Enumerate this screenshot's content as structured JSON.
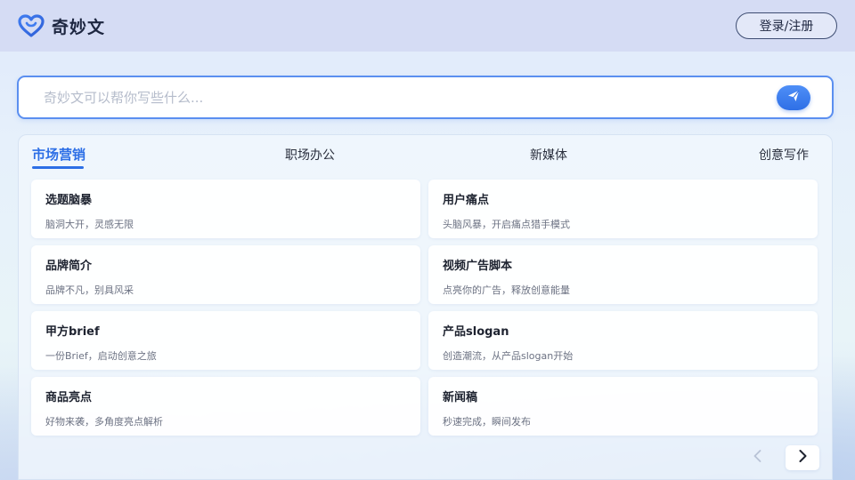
{
  "header": {
    "brand_name": "奇妙文",
    "login_label": "登录/注册"
  },
  "search": {
    "placeholder": "奇妙文可以帮你写些什么..."
  },
  "tabs": [
    {
      "label": "市场营销",
      "active": true
    },
    {
      "label": "职场办公",
      "active": false
    },
    {
      "label": "新媒体",
      "active": false
    },
    {
      "label": "创意写作",
      "active": false
    }
  ],
  "cards": [
    {
      "title": "选题脑暴",
      "desc": "脑洞大开，灵感无限"
    },
    {
      "title": "用户痛点",
      "desc": "头脑风暴，开启痛点猎手模式"
    },
    {
      "title": "品牌简介",
      "desc": "品牌不凡，别具风采"
    },
    {
      "title": "视频广告脚本",
      "desc": "点亮你的广告，释放创意能量"
    },
    {
      "title": "甲方brief",
      "desc": "一份Brief，启动创意之旅"
    },
    {
      "title": "产品slogan",
      "desc": "创造潮流，从产品slogan开始"
    },
    {
      "title": "商品亮点",
      "desc": "好物来袭，多角度亮点解析"
    },
    {
      "title": "新闻稿",
      "desc": "秒速完成，瞬间发布"
    }
  ],
  "pagination": {
    "prev_icon": "chevron-left-icon",
    "next_icon": "chevron-right-icon"
  },
  "colors": {
    "accent": "#2d6fe6",
    "header_bg": "#d5dcf4",
    "search_border": "#5b8ff0"
  }
}
